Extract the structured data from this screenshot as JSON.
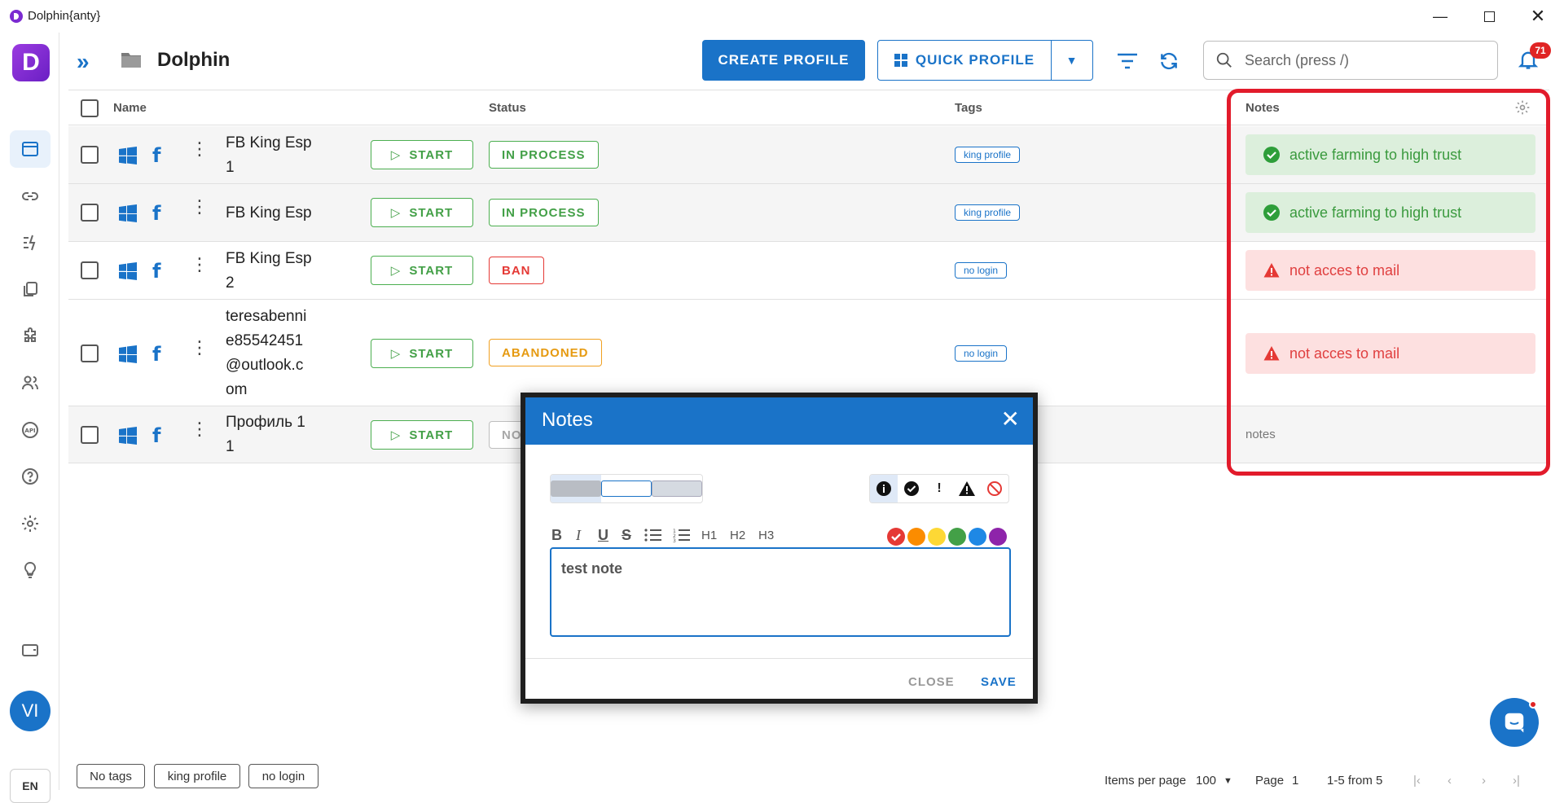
{
  "window": {
    "title": "Dolphin{anty}"
  },
  "header": {
    "folder_name": "Dolphin",
    "create_profile": "CREATE PROFILE",
    "quick_profile": "QUICK PROFILE",
    "search_placeholder": "Search (press /)",
    "notifications_count": "71"
  },
  "sidebar": {
    "logo": "D",
    "avatar": "VI",
    "language": "EN",
    "icons": [
      "browser-profiles-icon",
      "link-icon",
      "automation-icon",
      "copy-icon",
      "extensions-icon",
      "users-icon",
      "api-icon",
      "help-icon",
      "settings-icon",
      "lightbulb-icon",
      "wallet-icon"
    ]
  },
  "table": {
    "columns": {
      "name": "Name",
      "status": "Status",
      "tags": "Tags",
      "notes": "Notes"
    },
    "start_label": "START",
    "rows": [
      {
        "name_lines": [
          "FB King Esp",
          "1"
        ],
        "status": "IN PROCESS",
        "tag": "king profile",
        "note": "active farming to high trust"
      },
      {
        "name_lines": [
          "FB King Esp"
        ],
        "status": "IN PROCESS",
        "tag": "king profile",
        "note": "active farming to high trust"
      },
      {
        "name_lines": [
          "FB King Esp",
          "2"
        ],
        "status": "BAN",
        "tag": "no login",
        "note": "not acces to mail"
      },
      {
        "name_lines": [
          "teresabenni",
          "e85542451",
          "@outlook.c",
          "om"
        ],
        "status": "ABANDONED",
        "tag": "no login",
        "note": "not acces to mail"
      },
      {
        "name_lines": [
          "Профиль 1",
          "1"
        ],
        "status": "NO",
        "tag": "",
        "note": "notes"
      }
    ]
  },
  "footer": {
    "tags": [
      "No tags",
      "king profile",
      "no login"
    ],
    "items_per_page_label": "Items per page",
    "items_per_page_value": "100",
    "page_label": "Page",
    "page_value": "1",
    "range": "1-5 from 5"
  },
  "modal": {
    "title": "Notes",
    "toolbar": {
      "h1": "H1",
      "h2": "H2",
      "h3": "H3",
      "bold": "B",
      "italic": "I",
      "underline": "U",
      "strike": "S"
    },
    "content": "test note",
    "close": "CLOSE",
    "save": "SAVE",
    "color_swatches": [
      "#e53935",
      "#fb8c00",
      "#fdd835",
      "#43a047",
      "#1e88e5",
      "#8e24aa"
    ]
  },
  "colors": {
    "accent": "#1a73c8",
    "success": "#43a047",
    "danger": "#e53935",
    "warning": "#e69a10",
    "highlight": "#e21b2b"
  }
}
